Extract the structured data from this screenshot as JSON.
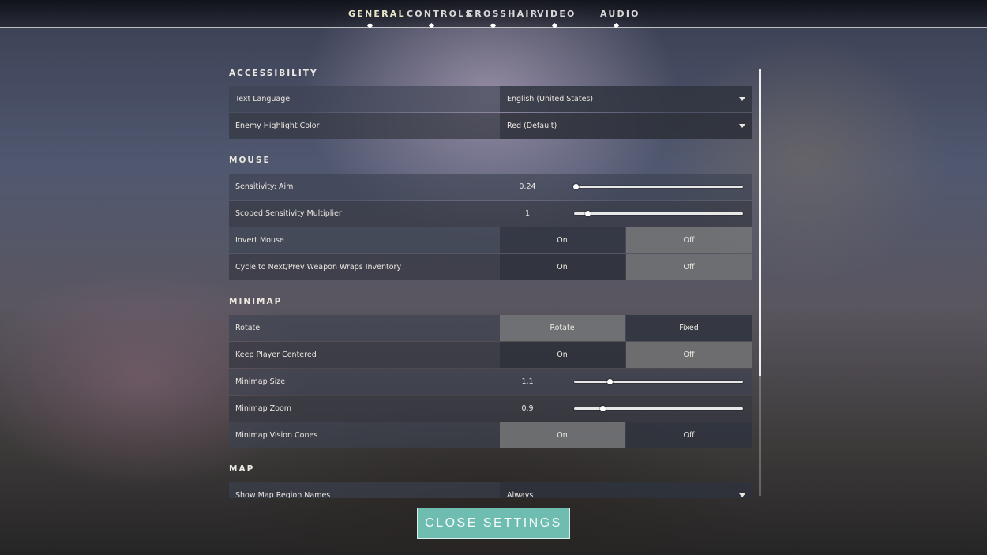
{
  "tabs": [
    {
      "label": "GENERAL",
      "active": true
    },
    {
      "label": "CONTROLS",
      "active": false
    },
    {
      "label": "CROSSHAIR",
      "active": false
    },
    {
      "label": "VIDEO",
      "active": false
    },
    {
      "label": "AUDIO",
      "active": false
    }
  ],
  "sections": {
    "accessibility": {
      "title": "ACCESSIBILITY",
      "text_language": {
        "label": "Text Language",
        "value": "English (United States)"
      },
      "enemy_highlight_color": {
        "label": "Enemy Highlight Color",
        "value": "Red (Default)"
      }
    },
    "mouse": {
      "title": "MOUSE",
      "sensitivity_aim": {
        "label": "Sensitivity: Aim",
        "value": "0.24",
        "fraction": 0.01
      },
      "scoped_sensitivity": {
        "label": "Scoped Sensitivity Multiplier",
        "value": "1",
        "fraction": 0.08
      },
      "invert_mouse": {
        "label": "Invert Mouse",
        "on": "On",
        "off": "Off",
        "selected": "off"
      },
      "cycle_weapon": {
        "label": "Cycle to Next/Prev Weapon Wraps Inventory",
        "on": "On",
        "off": "Off",
        "selected": "off"
      }
    },
    "minimap": {
      "title": "MINIMAP",
      "rotate": {
        "label": "Rotate",
        "on": "Rotate",
        "off": "Fixed",
        "selected": "on"
      },
      "keep_player_centered": {
        "label": "Keep Player Centered",
        "on": "On",
        "off": "Off",
        "selected": "off"
      },
      "minimap_size": {
        "label": "Minimap Size",
        "value": "1.1",
        "fraction": 0.21
      },
      "minimap_zoom": {
        "label": "Minimap Zoom",
        "value": "0.9",
        "fraction": 0.17
      },
      "vision_cones": {
        "label": "Minimap Vision Cones",
        "on": "On",
        "off": "Off",
        "selected": "on"
      }
    },
    "map": {
      "title": "MAP",
      "show_region_names": {
        "label": "Show Map Region Names",
        "value": "Always"
      }
    }
  },
  "close_button": {
    "label": "CLOSE SETTINGS"
  },
  "colors": {
    "accent": "#6fbcb0",
    "selected_option": "#7d7d7d"
  }
}
